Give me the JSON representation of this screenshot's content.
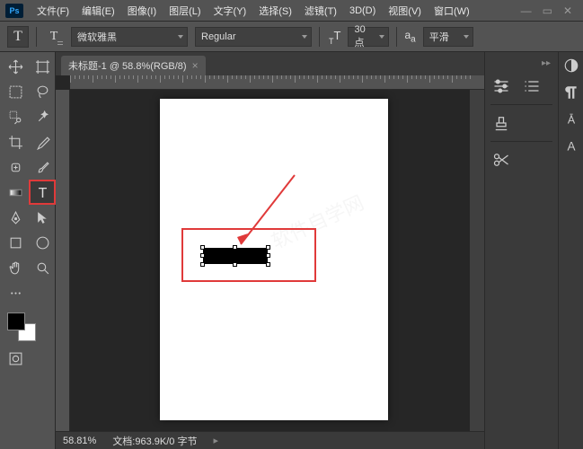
{
  "app": {
    "logo": "Ps"
  },
  "menu": {
    "file": "文件(F)",
    "edit": "编辑(E)",
    "image": "图像(I)",
    "layer": "图层(L)",
    "type": "文字(Y)",
    "select": "选择(S)",
    "filter": "滤镜(T)",
    "threed": "3D(D)",
    "view": "视图(V)",
    "window": "窗口(W)"
  },
  "options": {
    "font_family": "微软雅黑",
    "font_style": "Regular",
    "size_value": "30 点",
    "antialias": "平滑"
  },
  "document": {
    "tab_title": "未标题-1 @ 58.8%(RGB/8)",
    "zoom": "58.81%",
    "doc_info": "文档:963.9K/0 字节"
  },
  "watermark": "软件自学网"
}
